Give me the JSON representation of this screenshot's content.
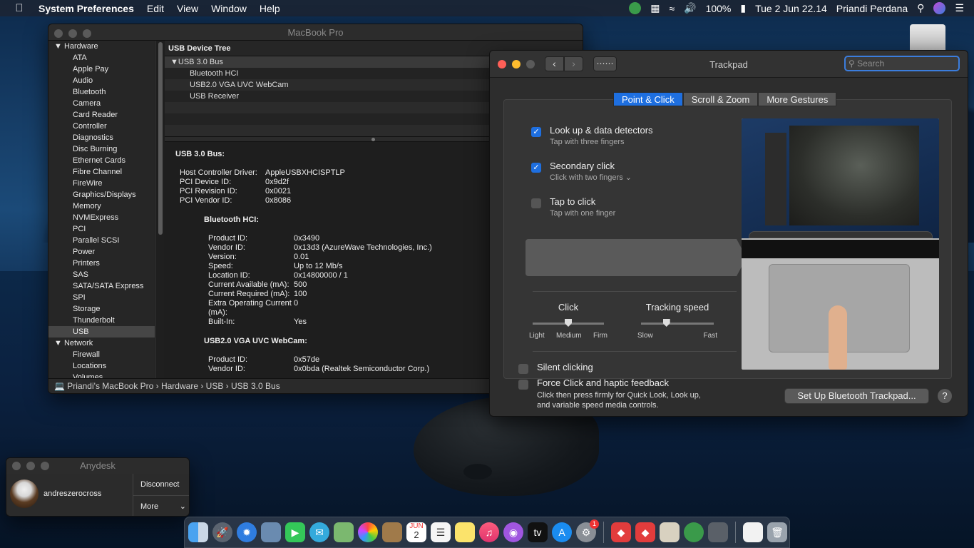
{
  "menubar": {
    "app": "System Preferences",
    "items": [
      "Edit",
      "View",
      "Window",
      "Help"
    ],
    "battery": "100%",
    "datetime": "Tue 2 Jun  22.14",
    "user": "Priandi Perdana"
  },
  "sysinfo": {
    "title": "MacBook Pro",
    "sidebar": [
      {
        "label": "Hardware",
        "group": true
      },
      {
        "label": "ATA"
      },
      {
        "label": "Apple Pay"
      },
      {
        "label": "Audio"
      },
      {
        "label": "Bluetooth"
      },
      {
        "label": "Camera"
      },
      {
        "label": "Card Reader"
      },
      {
        "label": "Controller"
      },
      {
        "label": "Diagnostics"
      },
      {
        "label": "Disc Burning"
      },
      {
        "label": "Ethernet Cards"
      },
      {
        "label": "Fibre Channel"
      },
      {
        "label": "FireWire"
      },
      {
        "label": "Graphics/Displays"
      },
      {
        "label": "Memory"
      },
      {
        "label": "NVMExpress"
      },
      {
        "label": "PCI"
      },
      {
        "label": "Parallel SCSI"
      },
      {
        "label": "Power"
      },
      {
        "label": "Printers"
      },
      {
        "label": "SAS"
      },
      {
        "label": "SATA/SATA Express"
      },
      {
        "label": "SPI"
      },
      {
        "label": "Storage"
      },
      {
        "label": "Thunderbolt"
      },
      {
        "label": "USB",
        "selected": true
      },
      {
        "label": "Network",
        "group": true
      },
      {
        "label": "Firewall"
      },
      {
        "label": "Locations"
      },
      {
        "label": "Volumes"
      }
    ],
    "tree_header": "USB Device Tree",
    "tree": [
      "USB 3.0 Bus",
      "Bluetooth HCI",
      "USB2.0 VGA UVC WebCam",
      "USB Receiver"
    ],
    "detail_title": "USB 3.0 Bus:",
    "bus_rows": [
      [
        "Host Controller Driver:",
        "AppleUSBXHCISPTLP"
      ],
      [
        "PCI Device ID:",
        "0x9d2f"
      ],
      [
        "PCI Revision ID:",
        "0x0021"
      ],
      [
        "PCI Vendor ID:",
        "0x8086"
      ]
    ],
    "bt_title": "Bluetooth HCI:",
    "bt_rows": [
      [
        "Product ID:",
        "0x3490"
      ],
      [
        "Vendor ID:",
        "0x13d3  (AzureWave Technologies, Inc.)"
      ],
      [
        "Version:",
        "0.01"
      ],
      [
        "Speed:",
        "Up to 12 Mb/s"
      ],
      [
        "Location ID:",
        "0x14800000 / 1"
      ],
      [
        "Current Available (mA):",
        "500"
      ],
      [
        "Current Required (mA):",
        "100"
      ],
      [
        "Extra Operating Current (mA):",
        "0"
      ],
      [
        "Built-In:",
        "Yes"
      ]
    ],
    "cam_title": "USB2.0 VGA UVC WebCam:",
    "cam_rows": [
      [
        "Product ID:",
        "0x57de"
      ],
      [
        "Vendor ID:",
        "0x0bda  (Realtek Semiconductor Corp.)"
      ]
    ],
    "path": "Priandi's MacBook Pro  ›  Hardware  ›  USB  ›  USB 3.0 Bus"
  },
  "trackpad": {
    "title": "Trackpad",
    "search_placeholder": "Search",
    "tabs": [
      "Point & Click",
      "Scroll & Zoom",
      "More Gestures"
    ],
    "options": [
      {
        "title": "Look up & data detectors",
        "sub": "Tap with three fingers",
        "checked": true
      },
      {
        "title": "Secondary click",
        "sub": "Click with two fingers ⌄",
        "checked": true
      },
      {
        "title": "Tap to click",
        "sub": "Tap with one finger",
        "checked": false
      }
    ],
    "click": {
      "label": "Click",
      "ends": [
        "Light",
        "Medium",
        "Firm"
      ],
      "value": 0.5
    },
    "speed": {
      "label": "Tracking speed",
      "ends": [
        "Slow",
        "Fast"
      ],
      "value": 0.35
    },
    "silent": "Silent clicking",
    "force": "Force Click and haptic feedback",
    "force_sub1": "Click then press firmly for Quick Look, Look up,",
    "force_sub2": "and variable speed media controls.",
    "setup_button": "Set Up Bluetooth Trackpad...",
    "help": "?"
  },
  "anydesk": {
    "title": "Anydesk",
    "user": "andreszerocross",
    "disconnect": "Disconnect",
    "more": "More"
  },
  "dock_calendar": {
    "month": "JUN",
    "day": "2"
  },
  "dock_badge": "1"
}
